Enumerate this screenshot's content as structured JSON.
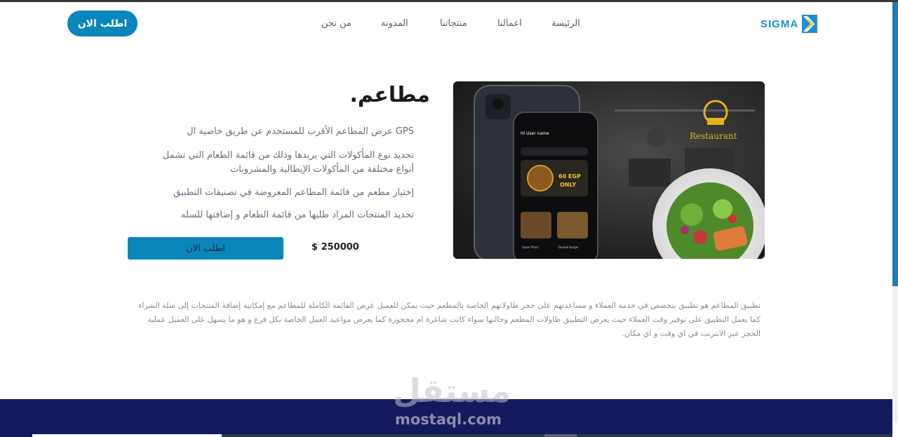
{
  "header": {
    "cta_label": "اطلب الان",
    "nav": [
      "من نحن",
      "المدونة",
      "منتجاتنا",
      "اعمالنا",
      "الرئيسة"
    ],
    "logo_text": "SIGMA"
  },
  "product": {
    "title": ".مطاعم",
    "bullets": [
      "GPS عرض المطاعم الأقرب للمستخدم عن طريق خاصية ال",
      "تحديد نوع المأكولات التي يريدها وذلك من قائمة الطعام التي تشمل أنواع مختلفة من المأكولات الإيطالية والمشروبات",
      "إختيار مطعم من قائمة المطاعم المعروضة في تصنيفات التطبيق",
      "تحديد المنتجات المراد طلبها من قائمة الطعام و إضافتها للسله"
    ],
    "order_label": "اطلب الان",
    "price": "$ 250000"
  },
  "hero": {
    "restaurant_label": "Restaurant",
    "phone_greeting": "Hi User name",
    "phone_promo_line1": "60 EGP",
    "phone_promo_line2": "ONLY",
    "phone_item_1": "Super Pizza",
    "phone_item_2": "Double burger"
  },
  "description": "تطبيق المطاعم هو تطبيق يتخصص في خدمة العملاء و مساعدتهم على حجز طاولاتهم الخاصة بالمطعم حيث يمكن للعميل عرض القائمة الكاملة للمطاعم مع إمكانية إضافة المنتجات إلى سلة الشراء كما يعمل التطبيق على توفير وقت العملاء حيث يعرض التطبيق طاولات المطعم وحالتها سواء كانت شاغرة ام محجوزة كما يعرض مواعيد العمل الخاصة بكل فرع و هو ما يسهل على العميل عملية الحجز عبر الانترنت في اي وقت و اي مكان.",
  "watermark": {
    "arabic": "مستقل",
    "latin": "mostaql.com"
  },
  "colors": {
    "accent": "#0a86bd",
    "footer": "#151a5e",
    "logo": "#1e8fcf"
  }
}
